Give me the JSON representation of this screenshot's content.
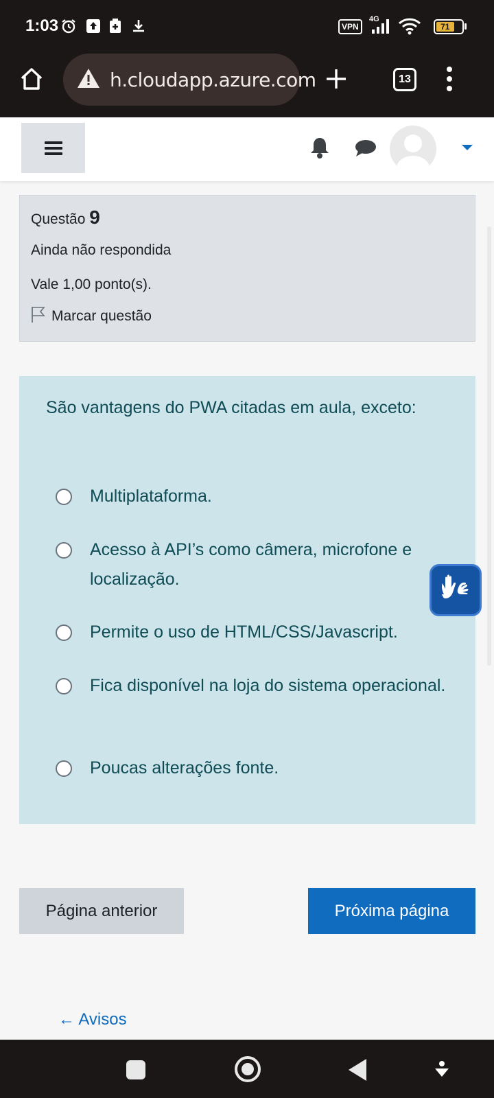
{
  "status_bar": {
    "time": "1:03",
    "vpn_label": "VPN",
    "network": "4G",
    "battery": "71",
    "battery_level": 0.71
  },
  "browser": {
    "url": "h.cloudapp.azure.com",
    "tab_count": "13"
  },
  "question_info": {
    "label": "Questão",
    "number": "9",
    "status": "Ainda não respondida",
    "grade": "Vale 1,00 ponto(s).",
    "flag_label": "Marcar questão"
  },
  "question": {
    "text": "São vantagens do PWA citadas em aula, exceto:",
    "options": [
      {
        "label": "Multiplataforma."
      },
      {
        "label": "Acesso à API’s como câmera, microfone e localização."
      },
      {
        "label": "Permite o uso de HTML/CSS/Javascript."
      },
      {
        "label": "Fica disponível na loja do sistema operacional."
      },
      {
        "label": "Poucas alterações fonte."
      }
    ]
  },
  "navigation": {
    "previous_label": "Página anterior",
    "next_label": "Próxima página",
    "back_link": "← Avisos"
  },
  "colors": {
    "primary": "#0f6cbf",
    "content_bg": "#cce4ea",
    "info_bg": "#dee2e6"
  }
}
